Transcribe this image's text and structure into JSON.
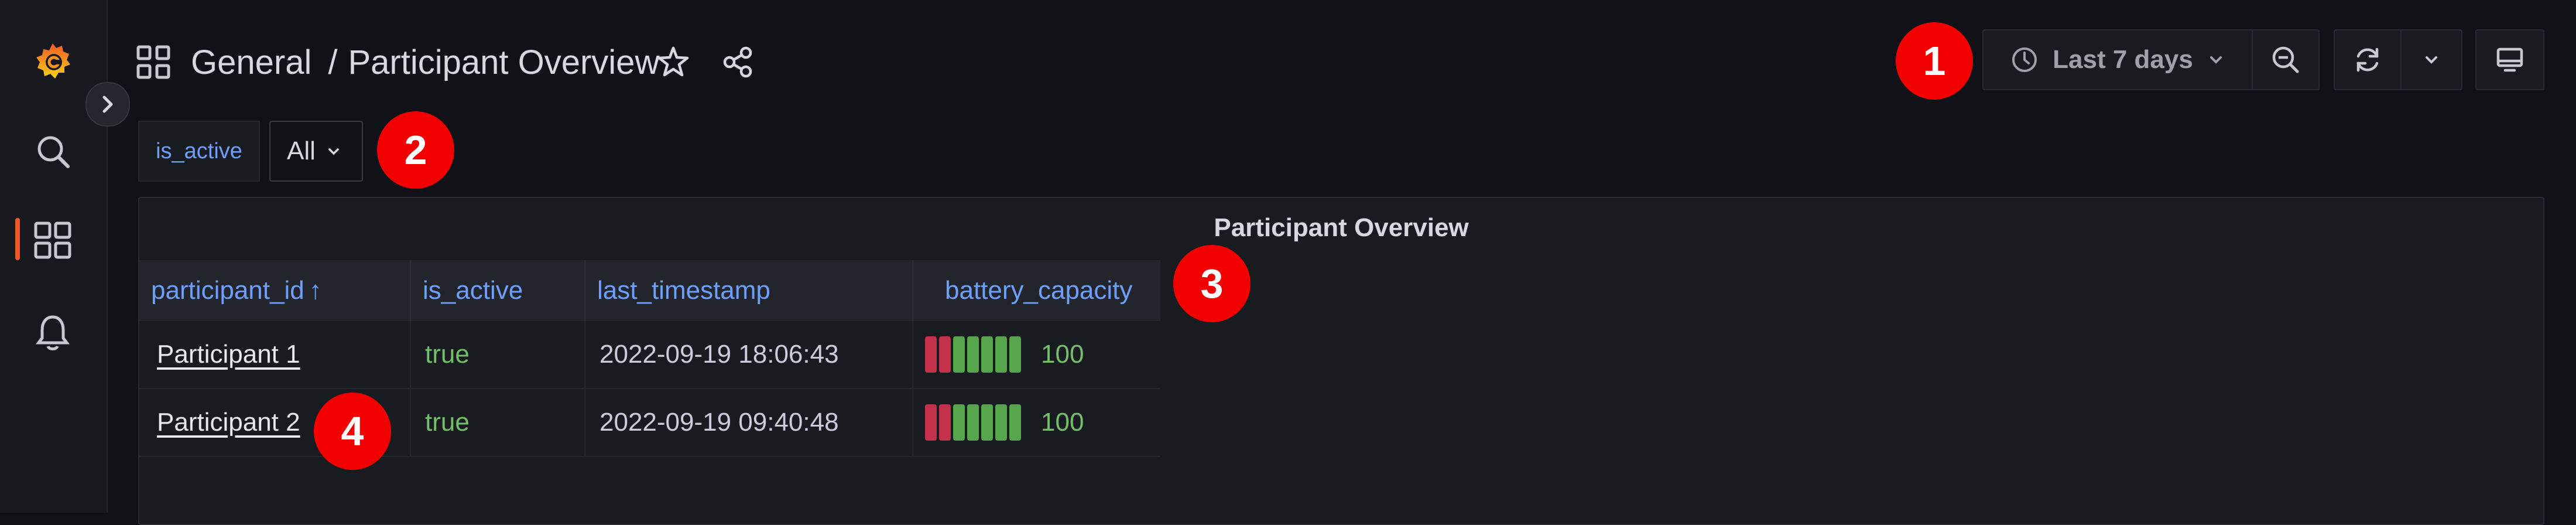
{
  "header": {
    "breadcrumb_folder": "General",
    "breadcrumb_separator": "/",
    "breadcrumb_dashboard": "Participant Overview"
  },
  "toolbar": {
    "time_range": "Last 7 days"
  },
  "variables": {
    "label": "is_active",
    "value": "All"
  },
  "panel": {
    "title": "Participant Overview",
    "columns": [
      "participant_id",
      "is_active",
      "last_timestamp",
      "battery_capacity"
    ],
    "sort_indicator": "↑",
    "rows": [
      {
        "participant_id": "Participant 1",
        "is_active": "true",
        "last_timestamp": "2022-09-19 18:06:43",
        "battery_capacity": "100"
      },
      {
        "participant_id": "Participant 2",
        "is_active": "true",
        "last_timestamp": "2022-09-19 09:40:48",
        "battery_capacity": "100"
      }
    ],
    "battery_level_fraction": 1.0
  },
  "markers": [
    "1",
    "2",
    "3",
    "4"
  ],
  "colors": {
    "accent": "#6e9fff",
    "brand": "#f05a28",
    "status_green": "#73bf69",
    "gauge_red": "#c4314b",
    "marker": "#f20000"
  },
  "icons": {
    "sidebar": [
      "grafana-logo-icon",
      "search-icon",
      "dashboards-icon",
      "bell-icon"
    ],
    "header": [
      "dashboard-grid-icon",
      "star-icon",
      "share-icon"
    ],
    "toolbar": [
      "clock-icon",
      "chevron-down-icon",
      "zoom-out-icon",
      "refresh-icon",
      "chevron-down-icon",
      "tv-icon"
    ]
  }
}
